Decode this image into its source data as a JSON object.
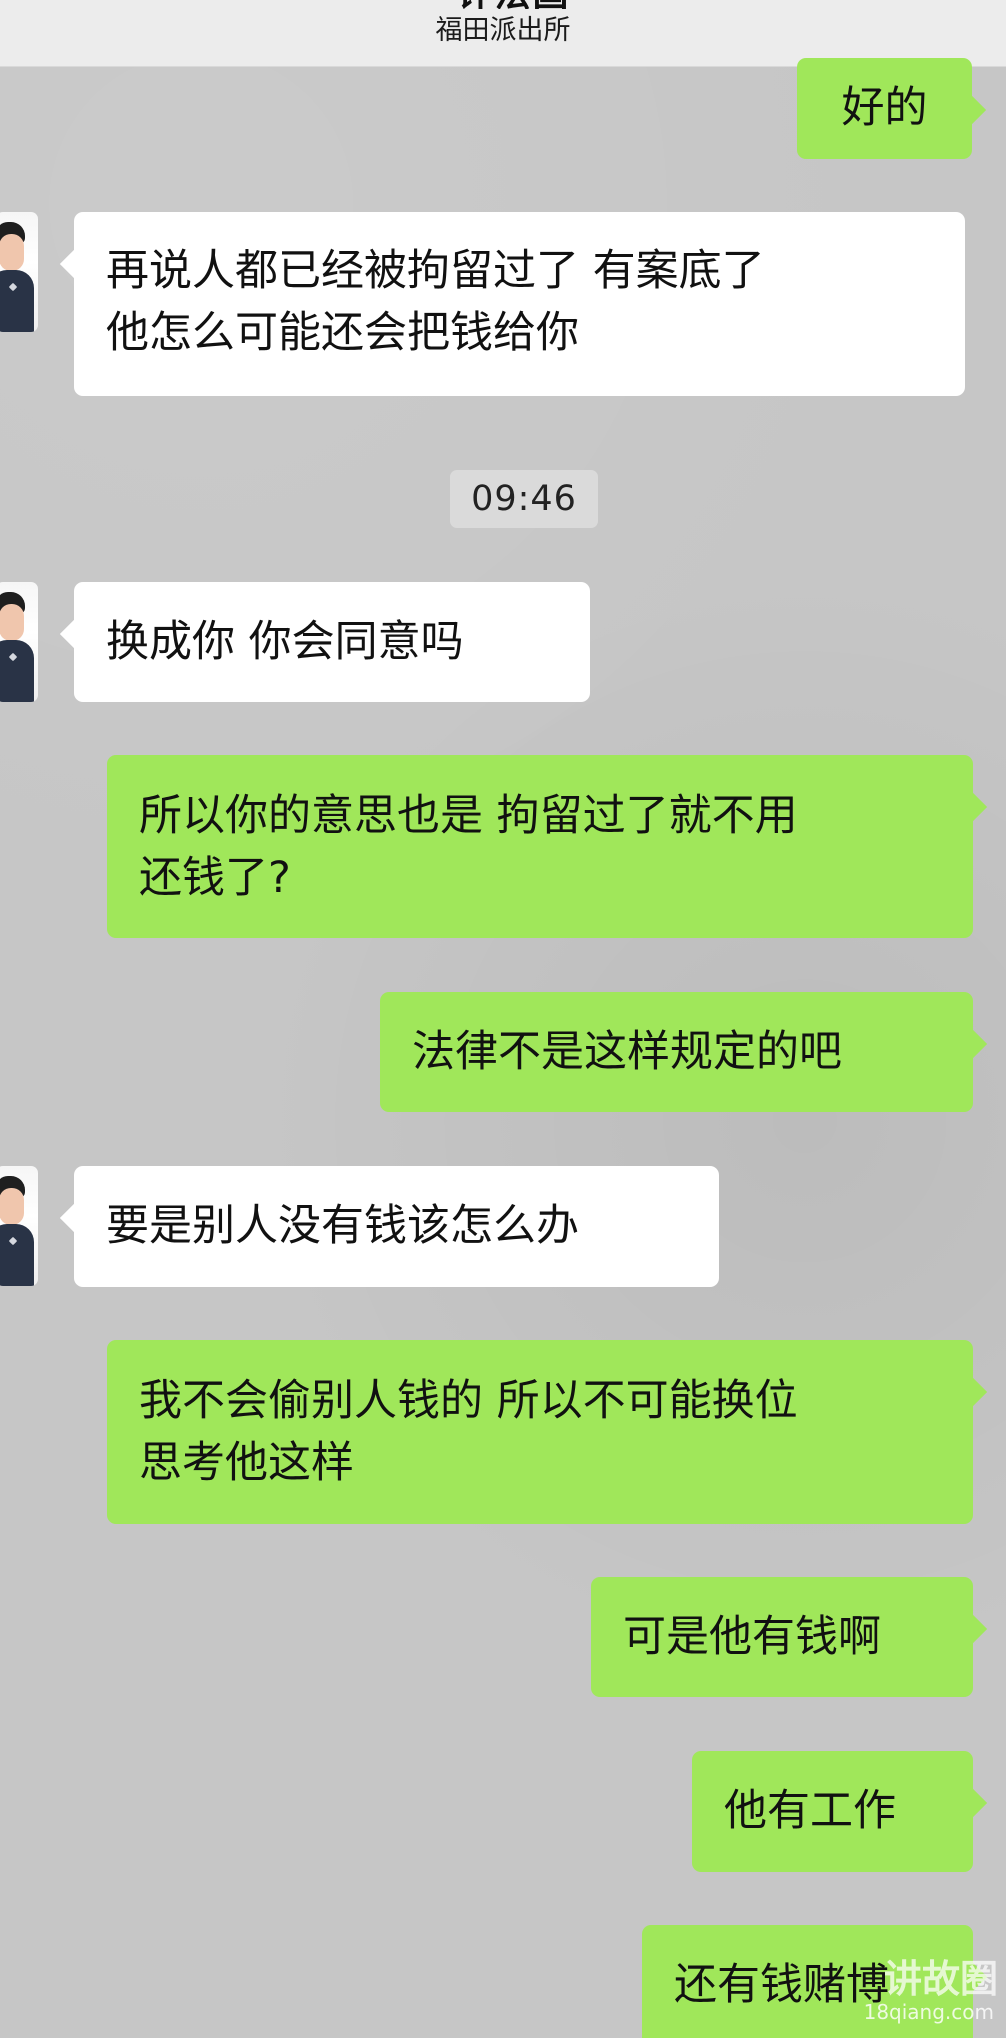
{
  "header": {
    "title": "许法国",
    "subtitle": "福田派出所"
  },
  "messages": [
    {
      "side": "right",
      "text": "好的"
    },
    {
      "side": "left",
      "text": "再说人都已经被拘留过了 有案底了\n他怎么可能还会把钱给你"
    },
    {
      "type": "time",
      "text": "09:46"
    },
    {
      "side": "left",
      "text": "换成你  你会同意吗"
    },
    {
      "side": "right",
      "text": "所以你的意思也是 拘留过了就不用\n还钱了?"
    },
    {
      "side": "right",
      "text": "法律不是这样规定的吧"
    },
    {
      "side": "left",
      "text": "要是别人没有钱该怎么办"
    },
    {
      "side": "right",
      "text": "我不会偷别人钱的 所以不可能换位\n思考他这样"
    },
    {
      "side": "right",
      "text": "可是他有钱啊"
    },
    {
      "side": "right",
      "text": "他有工作"
    },
    {
      "side": "right",
      "text": "还有钱赌博"
    }
  ],
  "watermark": {
    "mark": "讲故圈",
    "domain": "18qiang.com"
  },
  "colors": {
    "chat_background": "#c6c6c6",
    "incoming_bubble": "#ffffff",
    "outgoing_bubble": "#a0e75a",
    "time_pill": "#dadada"
  },
  "icons": {
    "contact_avatar": "avatar-icon"
  }
}
